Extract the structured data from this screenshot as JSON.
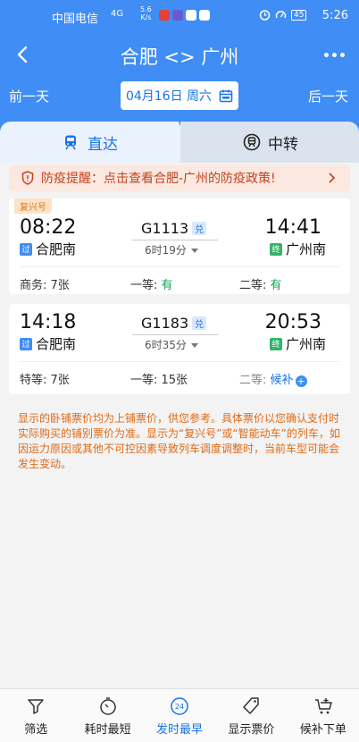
{
  "status_bar": {
    "carrier": "中国电信",
    "signal": "4G",
    "speed_value": "5.6",
    "speed_unit": "K/s",
    "battery": "45",
    "time": "5:26"
  },
  "header": {
    "title": "合肥 <> 广州"
  },
  "date_bar": {
    "prev_label": "前一天",
    "next_label": "后一天",
    "date": "04月16日 周六"
  },
  "tabs": [
    {
      "label": "直达",
      "active": true,
      "icon": "train-icon"
    },
    {
      "label": "中转",
      "active": false,
      "icon": "transfer-icon"
    }
  ],
  "notice": {
    "text": "防疫提醒：点击查看合肥-广州的防疫政策!"
  },
  "trains": [
    {
      "badge": "复兴号",
      "dep_time": "08:22",
      "dep_tag": "过",
      "dep_station": "合肥南",
      "train_no": "G1113",
      "dui": "兑",
      "duration": "6时19分",
      "arr_time": "14:41",
      "arr_tag": "终",
      "arr_station": "广州南",
      "seats": [
        {
          "label": "商务: ",
          "value": "7张",
          "style": "plain"
        },
        {
          "label": "一等: ",
          "value": "有",
          "style": "green"
        },
        {
          "label": "二等: ",
          "value": "有",
          "style": "green"
        }
      ]
    },
    {
      "badge": "",
      "dep_time": "14:18",
      "dep_tag": "过",
      "dep_station": "合肥南",
      "train_no": "G1183",
      "dui": "兑",
      "duration": "6时35分",
      "arr_time": "20:53",
      "arr_tag": "终",
      "arr_station": "广州南",
      "seats": [
        {
          "label": "特等: ",
          "value": "7张",
          "style": "plain"
        },
        {
          "label": "一等: ",
          "value": "15张",
          "style": "plain"
        },
        {
          "label": "二等: ",
          "value": "候补",
          "style": "blue"
        }
      ]
    }
  ],
  "disclaimer": "显示的卧铺票价均为上铺票价，供您参考。具体票价以您确认支付时实际购买的铺别票价为准。显示为“复兴号”或“智能动车”的列车，如因运力原因或其他不可控因素导致列车调度调整时，当前车型可能会发生变动。",
  "bottom_bar": [
    {
      "label": "筛选",
      "icon": "filter-icon",
      "active": false
    },
    {
      "label": "耗时最短",
      "icon": "stopwatch-icon",
      "active": false
    },
    {
      "label": "发时最早",
      "icon": "clock-24-icon",
      "active": true
    },
    {
      "label": "显示票价",
      "icon": "price-tag-icon",
      "active": false
    },
    {
      "label": "候补下单",
      "icon": "cart-add-icon",
      "active": false
    }
  ],
  "colors": {
    "brand_blue": "#3f8df5",
    "notice_red": "#c3421e",
    "available_green": "#18a058",
    "disclaimer_orange": "#e06a16"
  }
}
